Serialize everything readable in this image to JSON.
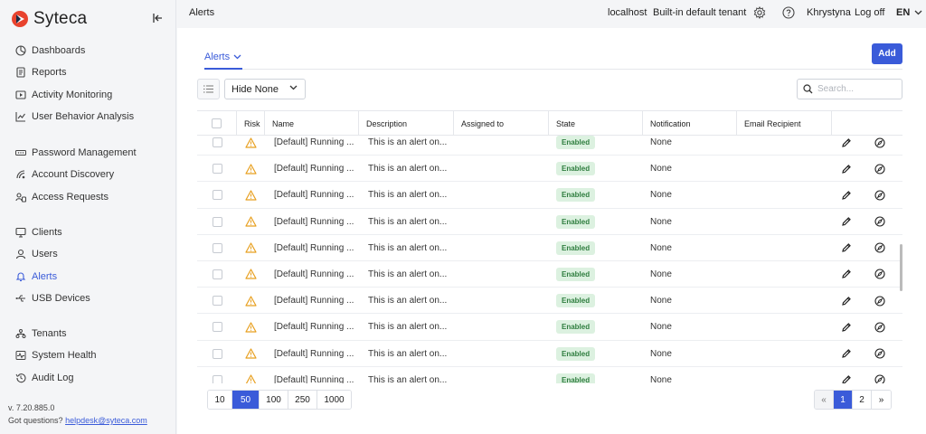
{
  "app": {
    "name": "Syteca",
    "brand_color": "#e8432e",
    "accent_color": "#3a5bd9"
  },
  "sidebar": {
    "groups": [
      [
        {
          "label": "Dashboards",
          "icon": "dashboard-icon"
        },
        {
          "label": "Reports",
          "icon": "report-icon"
        },
        {
          "label": "Activity Monitoring",
          "icon": "play-icon"
        },
        {
          "label": "User Behavior Analysis",
          "icon": "chart-icon"
        }
      ],
      [
        {
          "label": "Password Management",
          "icon": "password-icon"
        },
        {
          "label": "Account Discovery",
          "icon": "radar-icon"
        },
        {
          "label": "Access Requests",
          "icon": "access-icon"
        }
      ],
      [
        {
          "label": "Clients",
          "icon": "monitor-icon"
        },
        {
          "label": "Users",
          "icon": "user-icon"
        },
        {
          "label": "Alerts",
          "icon": "bell-icon",
          "active": true
        },
        {
          "label": "USB Devices",
          "icon": "usb-icon"
        }
      ],
      [
        {
          "label": "Tenants",
          "icon": "tenants-icon"
        },
        {
          "label": "System Health",
          "icon": "health-icon"
        },
        {
          "label": "Audit Log",
          "icon": "history-icon"
        }
      ]
    ],
    "version": "v. 7.20.885.0",
    "questions_prefix": "Got questions?",
    "help_email": "helpdesk@syteca.com"
  },
  "topbar": {
    "page_name": "Alerts",
    "host": "localhost",
    "tenant": "Built-in default tenant",
    "user": "Khrystyna",
    "logoff": "Log off",
    "language": "EN"
  },
  "main": {
    "tab_label": "Alerts",
    "add_label": "Add",
    "filter_value": "Hide None",
    "search_placeholder": "Search..."
  },
  "table": {
    "columns": [
      "Risk",
      "Name",
      "Description",
      "Assigned to",
      "State",
      "Notification",
      "Email Recipient"
    ],
    "rows": [
      {
        "name": "[Default] Running ...",
        "description": "This is an alert on...",
        "assigned": "",
        "state": "Enabled",
        "notification": "None",
        "email": ""
      },
      {
        "name": "[Default] Running ...",
        "description": "This is an alert on...",
        "assigned": "",
        "state": "Enabled",
        "notification": "None",
        "email": ""
      },
      {
        "name": "[Default] Running ...",
        "description": "This is an alert on...",
        "assigned": "",
        "state": "Enabled",
        "notification": "None",
        "email": ""
      },
      {
        "name": "[Default] Running ...",
        "description": "This is an alert on...",
        "assigned": "",
        "state": "Enabled",
        "notification": "None",
        "email": ""
      },
      {
        "name": "[Default] Running ...",
        "description": "This is an alert on...",
        "assigned": "",
        "state": "Enabled",
        "notification": "None",
        "email": ""
      },
      {
        "name": "[Default] Running ...",
        "description": "This is an alert on...",
        "assigned": "",
        "state": "Enabled",
        "notification": "None",
        "email": ""
      },
      {
        "name": "[Default] Running ...",
        "description": "This is an alert on...",
        "assigned": "",
        "state": "Enabled",
        "notification": "None",
        "email": ""
      },
      {
        "name": "[Default] Running ...",
        "description": "This is an alert on...",
        "assigned": "",
        "state": "Enabled",
        "notification": "None",
        "email": ""
      },
      {
        "name": "[Default] Running ...",
        "description": "This is an alert on...",
        "assigned": "",
        "state": "Enabled",
        "notification": "None",
        "email": ""
      },
      {
        "name": "[Default] Running ...",
        "description": "This is an alert on...",
        "assigned": "",
        "state": "Enabled",
        "notification": "None",
        "email": ""
      }
    ]
  },
  "pagination": {
    "page_sizes": [
      "10",
      "50",
      "100",
      "250",
      "1000"
    ],
    "active_page_size": "50",
    "prev": "«",
    "pages": [
      "1",
      "2"
    ],
    "active_page": "1",
    "next": "»"
  }
}
